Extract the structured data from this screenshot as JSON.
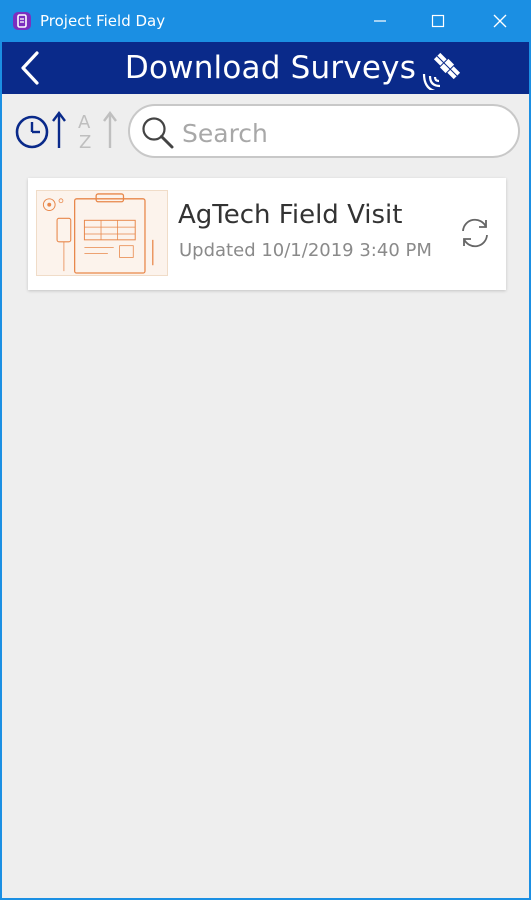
{
  "window": {
    "title": "Project Field Day"
  },
  "header": {
    "title": "Download Surveys"
  },
  "toolbar": {
    "search_placeholder": "Search",
    "search_value": ""
  },
  "surveys": [
    {
      "title": "AgTech Field Visit",
      "updated": "Updated 10/1/2019 3:40 PM"
    }
  ],
  "colors": {
    "titlebar": "#1b8fe3",
    "header": "#0a2a8a",
    "background": "#eeeeee",
    "thumbnail_accent": "#e8874a"
  },
  "icons": {
    "app": "app-icon",
    "back": "chevron-left-icon",
    "satellite": "satellite-icon",
    "sort_time": "clock-sort-icon",
    "sort_alpha": "az-sort-icon",
    "search": "search-icon",
    "refresh": "refresh-icon"
  }
}
